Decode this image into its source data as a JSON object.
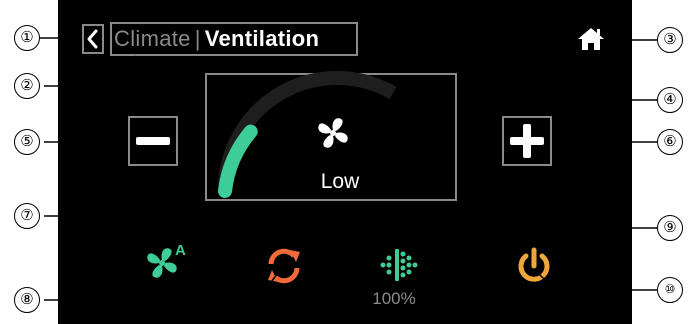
{
  "header": {
    "back_icon": "chevron-left-icon",
    "breadcrumb_parent": "Climate",
    "breadcrumb_separator": "|",
    "title": "Ventilation",
    "home_icon": "home-icon"
  },
  "fan": {
    "icon": "fan-icon",
    "speed_label": "Low",
    "level_fraction": 0.33,
    "decrease_icon": "minus-icon",
    "increase_icon": "plus-icon"
  },
  "actions": {
    "auto_fan": {
      "icon": "auto-fan-icon",
      "badge": "A"
    },
    "recirculation": {
      "icon": "recirculation-icon"
    },
    "filter": {
      "icon": "filter-icon",
      "value": "100%"
    },
    "power": {
      "icon": "power-icon"
    }
  },
  "callouts": [
    "①",
    "②",
    "③",
    "④",
    "⑤",
    "⑥",
    "⑦",
    "⑧",
    "⑨",
    "⑩"
  ],
  "colors": {
    "background": "#000000",
    "accent_green": "#3ecc98",
    "accent_orange": "#f26a3a",
    "accent_yellow": "#f0a73a",
    "frame_gray": "#8a8a8a"
  }
}
